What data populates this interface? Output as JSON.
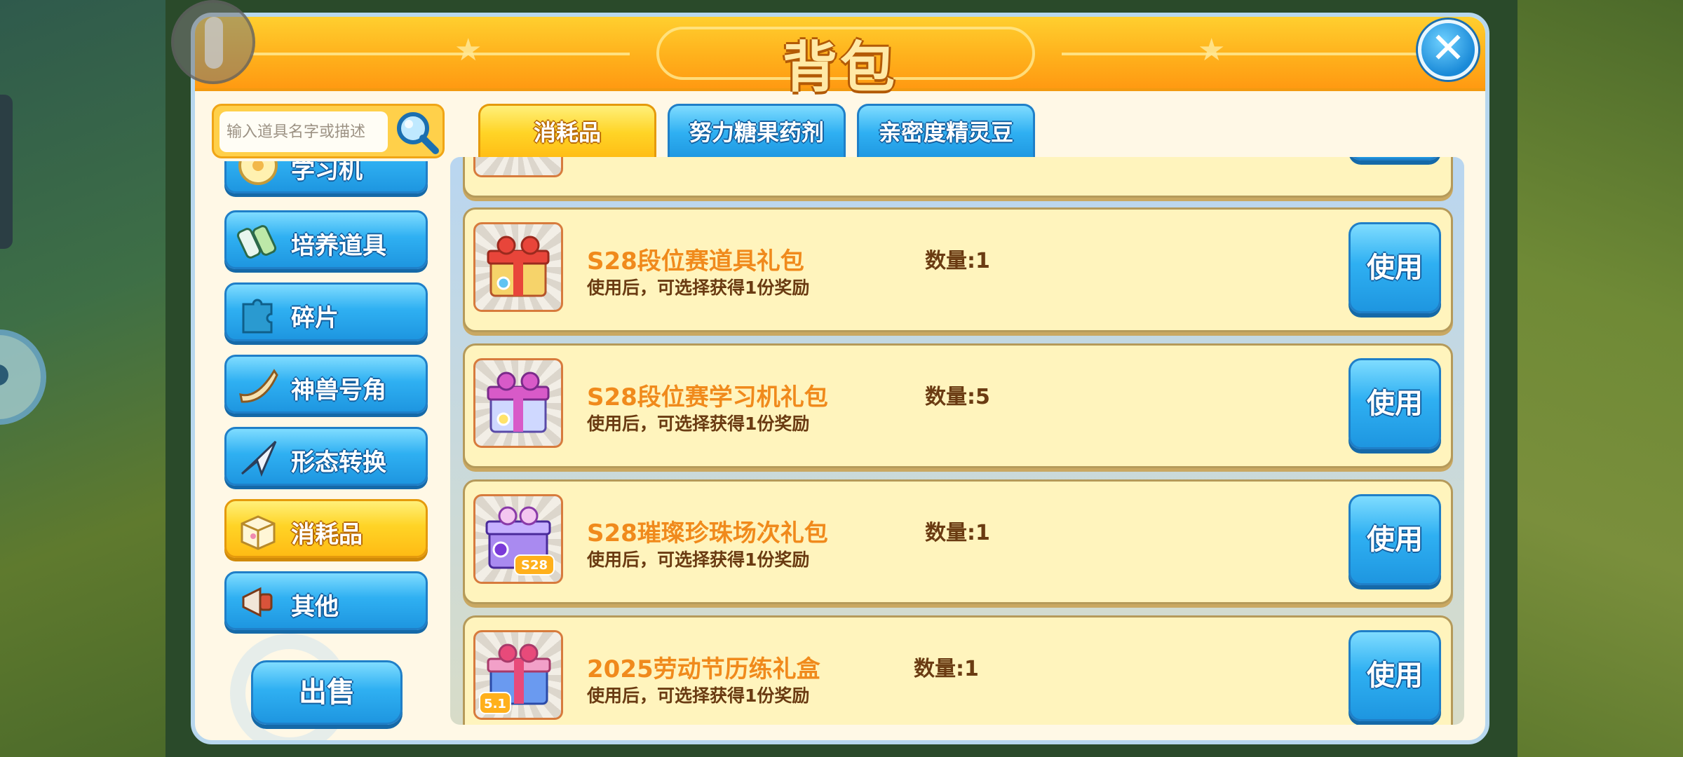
{
  "window": {
    "title": "背包"
  },
  "search": {
    "placeholder": "输入道具名字或描述"
  },
  "sidebar": {
    "items": [
      {
        "label": "学习机",
        "icon": "disc-icon",
        "active": false
      },
      {
        "label": "培养道具",
        "icon": "potion-icon",
        "active": false
      },
      {
        "label": "碎片",
        "icon": "puzzle-icon",
        "active": false
      },
      {
        "label": "神兽号角",
        "icon": "horn-icon",
        "active": false
      },
      {
        "label": "形态转换",
        "icon": "plane-icon",
        "active": false
      },
      {
        "label": "消耗品",
        "icon": "box-icon",
        "active": true
      },
      {
        "label": "其他",
        "icon": "megaphone-icon",
        "active": false
      }
    ]
  },
  "sell_button": "出售",
  "tabs": [
    {
      "label": "消耗品",
      "active": true
    },
    {
      "label": "努力糖果药剂",
      "active": false
    },
    {
      "label": "亲密度精灵豆",
      "active": false
    }
  ],
  "items": [
    {
      "name": "S28段位赛道具礼包",
      "desc": "使用后，可选择获得1份奖励",
      "qty": "数量:1",
      "use": "使用",
      "icon": "red-gift-icon"
    },
    {
      "name": "S28段位赛学习机礼包",
      "desc": "使用后，可选择获得1份奖励",
      "qty": "数量:5",
      "use": "使用",
      "icon": "purple-gift-icon"
    },
    {
      "name": "S28璀璨珍珠场次礼包",
      "desc": "使用后，可选择获得1份奖励",
      "qty": "数量:1",
      "use": "使用",
      "icon": "pearl-gift-icon",
      "badge": "S28"
    },
    {
      "name": "2025劳动节历练礼盒",
      "desc": "使用后，可选择获得1份奖励",
      "qty": "数量:1",
      "use": "使用",
      "icon": "labor-day-gift-icon",
      "badge": "5.1"
    }
  ],
  "colors": {
    "accent_orange": "#ffb11c",
    "button_blue": "#2fb0f2",
    "item_name": "#f08a1c",
    "item_text": "#6a3b12"
  }
}
